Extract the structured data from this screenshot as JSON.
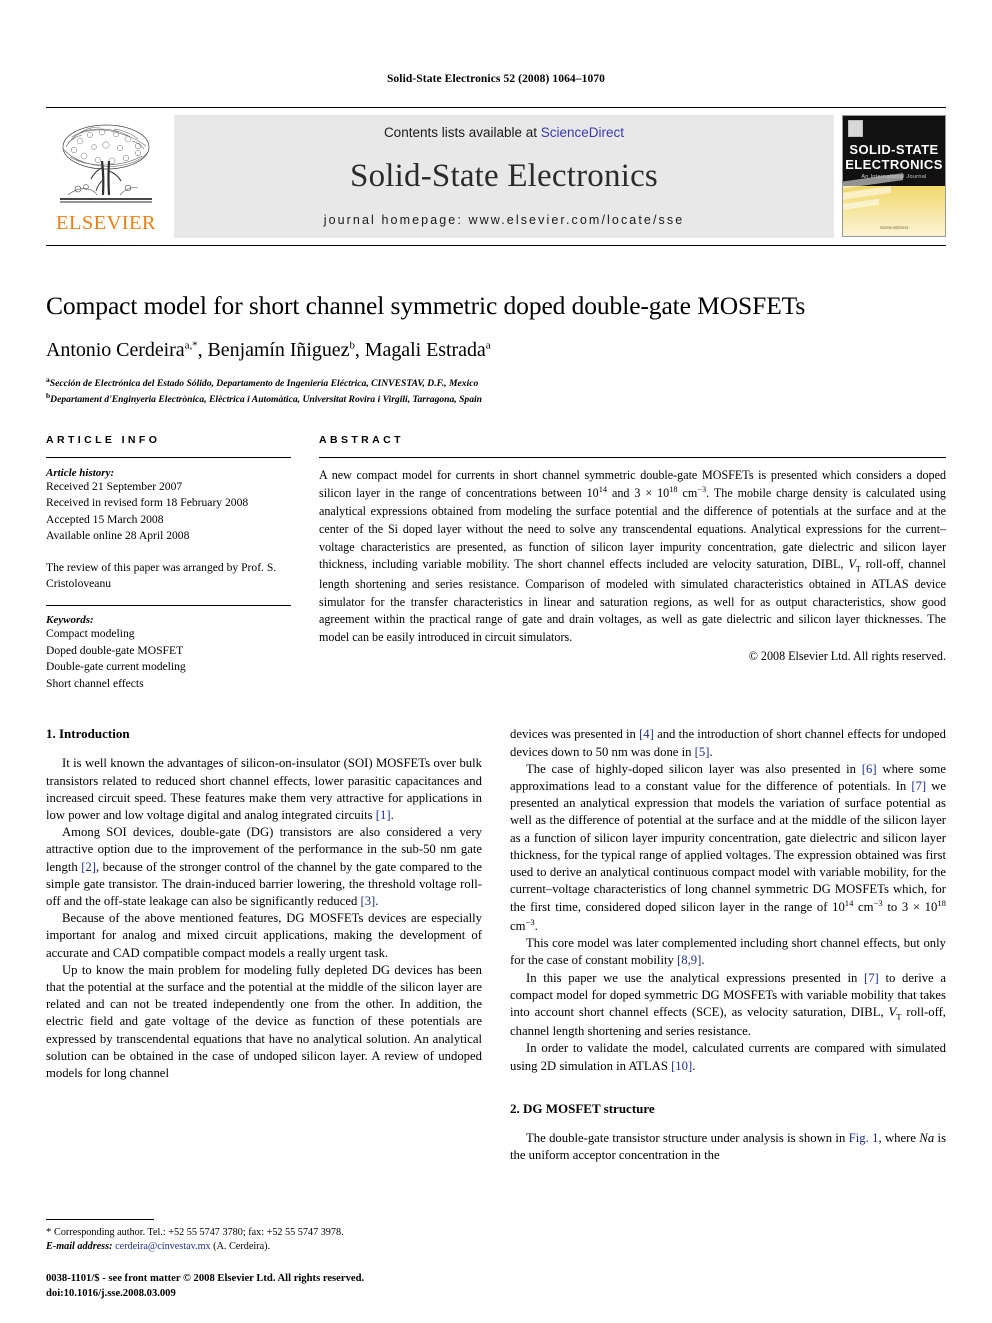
{
  "running_head": "Solid-State Electronics 52 (2008) 1064–1070",
  "masthead": {
    "publisher_wordmark": "ELSEVIER",
    "contents_prefix": "Contents lists available at ",
    "contents_link": "ScienceDirect",
    "journal_title": "Solid-State Electronics",
    "homepage": "journal homepage: www.elsevier.com/locate/sse",
    "cover": {
      "line1": "SOLID-STATE",
      "line2": "ELECTRONICS",
      "subtitle": "An International Journal",
      "footer": "Available online at",
      "publisher": "ScienceDirect"
    }
  },
  "title": "Compact model for short channel symmetric doped double-gate MOSFETs",
  "authors": {
    "a1_name": "Antonio Cerdeira",
    "a1_sup": "a,*",
    "sep1": ", ",
    "a2_name": "Benjamín Iñiguez",
    "a2_sup": "b",
    "sep2": ", ",
    "a3_name": "Magali Estrada",
    "a3_sup": "a"
  },
  "affiliations": [
    {
      "marker": "a",
      "text": "Sección de Electrónica del Estado Sólido, Departamento de Ingeniería Eléctrica, CINVESTAV, D.F., Mexico"
    },
    {
      "marker": "b",
      "text": "Departament d'Enginyeria Electrònica, Elèctrica i Automàtica, Universitat Rovira i Virgili, Tarragona, Spain"
    }
  ],
  "article_info": {
    "label": "ARTICLE INFO",
    "history_title": "Article history:",
    "history": [
      "Received 21 September 2007",
      "Received in revised form 18 February 2008",
      "Accepted 15 March 2008",
      "Available online 28 April 2008"
    ],
    "review_note": "The review of this paper was arranged by Prof. S. Cristoloveanu",
    "keywords_title": "Keywords:",
    "keywords": [
      "Compact modeling",
      "Doped double-gate MOSFET",
      "Double-gate current modeling",
      "Short channel effects"
    ]
  },
  "abstract": {
    "label": "ABSTRACT",
    "p1_a": "A new compact model for currents in short channel symmetric double-gate MOSFETs is presented which considers a doped silicon layer in the range of concentrations between 10",
    "p1_sup1": "14",
    "p1_b": " and 3 × 10",
    "p1_sup2": "18",
    "p1_c": " cm",
    "p1_sup3": "−3",
    "p1_d": ". The mobile charge density is calculated using analytical expressions obtained from modeling the surface potential and the difference of potentials at the surface and at the center of the Si doped layer without the need to solve any transcendental equations. Analytical expressions for the current–voltage characteristics are presented, as function of silicon layer impurity concentration, gate dielectric and silicon layer thickness, including variable mobility. The short channel effects included are velocity saturation, DIBL, ",
    "p1_vt": "V",
    "p1_vt_sub": "T",
    "p1_e": " roll-off, channel length shortening and series resistance. Comparison of modeled with simulated characteristics obtained in ATLAS device simulator for the transfer characteristics in linear and saturation regions, as well for as output characteristics, show good agreement within the practical range of gate and drain voltages, as well as gate dielectric and silicon layer thicknesses. The model can be easily introduced in circuit simulators.",
    "copyright": "© 2008 Elsevier Ltd. All rights reserved."
  },
  "sections": {
    "intro_heading": "1. Introduction",
    "structure_heading": "2. DG MOSFET structure"
  },
  "left_column": {
    "p1_a": "It is well known the advantages of silicon-on-insulator (SOI) MOSFETs over bulk transistors related to reduced short channel effects, lower parasitic capacitances and increased circuit speed. These features make them very attractive for applications in low power and low voltage digital and analog integrated circuits ",
    "p1_cite": "[1]",
    "p1_b": ".",
    "p2_a": "Among SOI devices, double-gate (DG) transistors are also considered a very attractive option due to the improvement of the performance in the sub-50 nm gate length ",
    "p2_cite1": "[2]",
    "p2_b": ", because of the stronger control of the channel by the gate compared to the simple gate transistor. The drain-induced barrier lowering, the threshold voltage roll-off and the off-state leakage can also be significantly reduced ",
    "p2_cite2": "[3]",
    "p2_c": ".",
    "p3": "Because of the above mentioned features, DG MOSFETs devices are especially important for analog and mixed circuit applications, making the development of accurate and CAD compatible compact models a really urgent task.",
    "p4": "Up to know the main problem for modeling fully depleted DG devices has been that the potential at the surface and the potential at the middle of the silicon layer are related and can not be treated independently one from the other. In addition, the electric field and gate voltage of the device as function of these potentials are expressed by transcendental equations that have no analytical solution. An analytical solution can be obtained in the case of undoped silicon layer. A review of undoped models for long channel"
  },
  "right_column": {
    "p1_a": "devices was presented in ",
    "p1_cite1": "[4]",
    "p1_b": " and the introduction of short channel effects for undoped devices down to 50 nm was done in ",
    "p1_cite2": "[5]",
    "p1_c": ".",
    "p2_a": "The case of highly-doped silicon layer was also presented in ",
    "p2_cite1": "[6]",
    "p2_b": " where some approximations lead to a constant value for the difference of potentials. In ",
    "p2_cite2": "[7]",
    "p2_c": " we presented an analytical expression that models the variation of surface potential as well as the difference of potential at the surface and at the middle of the silicon layer as a function of silicon layer impurity concentration, gate dielectric and silicon layer thickness, for the typical range of applied voltages. The expression obtained was first used to derive an analytical continuous compact model with variable mobility, for the current–voltage characteristics of long channel symmetric DG MOSFETs which, for the first time, considered doped silicon layer in the range of 10",
    "p2_sup1": "14",
    "p2_d": " cm",
    "p2_sup2": "−3",
    "p2_e": " to 3 × 10",
    "p2_sup3": "18",
    "p2_f": " cm",
    "p2_sup4": "−3",
    "p2_g": ".",
    "p3_a": "This core model was later complemented including short channel effects, but only for the case of constant mobility ",
    "p3_cite": "[8,9]",
    "p3_b": ".",
    "p4_a": "In this paper we use the analytical expressions presented in ",
    "p4_cite": "[7]",
    "p4_b": " to derive a compact model for doped symmetric DG MOSFETs with variable mobility that takes into account short channel effects (SCE), as velocity saturation, DIBL, ",
    "p4_vt": "V",
    "p4_vt_sub": "T",
    "p4_c": " roll-off, channel length shortening and series resistance.",
    "p5_a": "In order to validate the model, calculated currents are compared with simulated using 2D simulation in ATLAS ",
    "p5_cite": "[10]",
    "p5_b": ".",
    "p6_a": "The double-gate transistor structure under analysis is shown in ",
    "p6_figlink": "Fig. 1",
    "p6_b": ", where ",
    "p6_na": "Na",
    "p6_c": " is the uniform acceptor concentration in the"
  },
  "footnotes": {
    "corresponding": "Corresponding author. Tel.: +52 55 5747 3780; fax: +52 55 5747 3978.",
    "email_label": "E-mail address:",
    "email": "cerdeira@cinvestav.mx",
    "email_owner": "(A. Cerdeira).",
    "issn_line": "0038-1101/$ - see front matter © 2008 Elsevier Ltd. All rights reserved.",
    "doi_line": "doi:10.1016/j.sse.2008.03.009"
  },
  "colors": {
    "elsevier_orange": "#f07f13",
    "link_blue": "#1c2f8c",
    "sciencedirect_blue": "#3a3ab0",
    "banner_gray": "#e8e8e8",
    "cover_gold": "#f0d86a"
  }
}
